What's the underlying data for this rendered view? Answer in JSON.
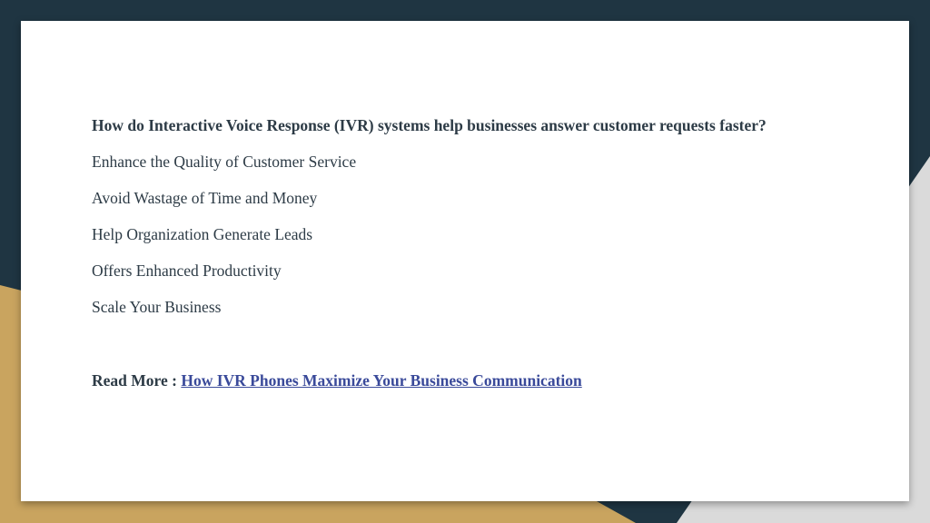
{
  "slide": {
    "question": "How do Interactive Voice Response (IVR) systems help businesses answer customer requests faster?",
    "items": [
      "Enhance the Quality of Customer Service",
      "Avoid Wastage of Time and Money",
      "Help Organization Generate Leads",
      "Offers Enhanced Productivity",
      "Scale Your Business"
    ],
    "read_more_label": "Read More :",
    "read_more_link_text": "How IVR Phones Maximize Your Business Communication"
  },
  "colors": {
    "background_dark": "#1f3542",
    "background_gold": "#c9a45f",
    "background_light": "#dadada",
    "text": "#2d3b46",
    "link": "#3a4a9a"
  }
}
